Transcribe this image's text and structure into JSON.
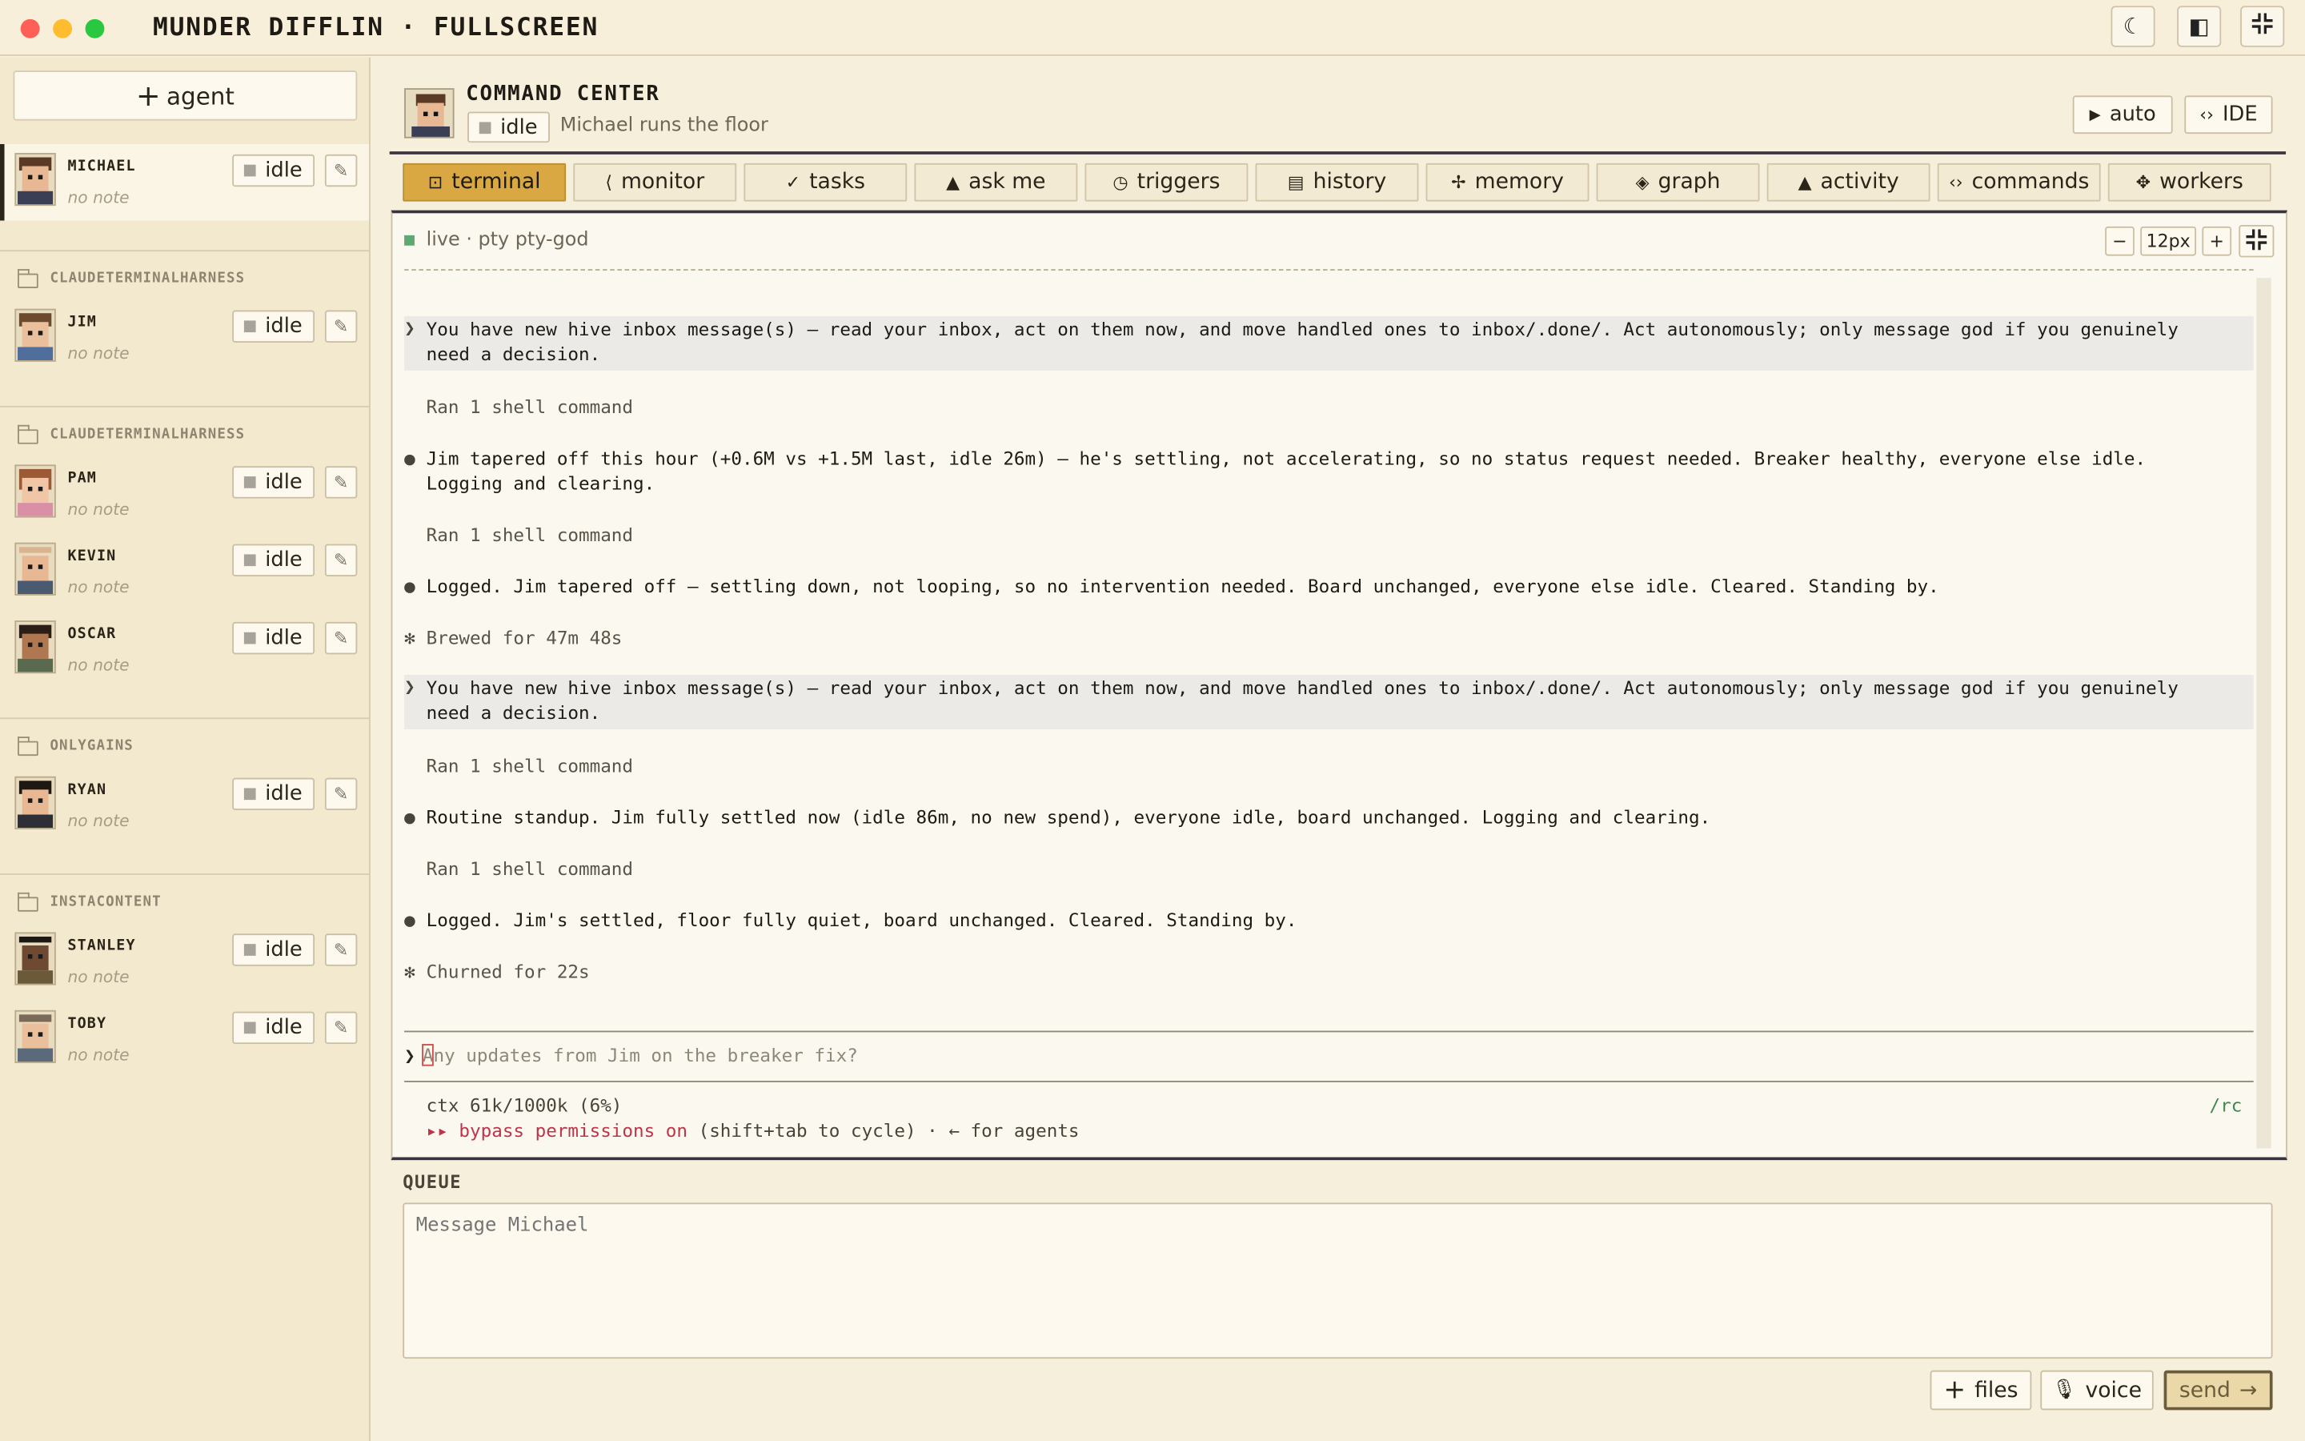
{
  "window": {
    "title": "MUNDER DIFFLIN · FULLSCREEN"
  },
  "titlebar_buttons": [
    {
      "icon": "moon-icon",
      "glyph": "☾"
    },
    {
      "icon": "sidebar-toggle-icon",
      "glyph": "◧"
    },
    {
      "icon": "fullscreen-exit-icon",
      "glyph": "⊹"
    }
  ],
  "sidebar": {
    "add_agent_label": "agent",
    "active_agent": {
      "name": "MICHAEL",
      "note": "no note",
      "status": "idle"
    },
    "groups": [
      {
        "name": "CLAUDETERMINALHARNESS",
        "agents": [
          {
            "name": "JIM",
            "note": "no note",
            "status": "idle"
          }
        ]
      },
      {
        "name": "CLAUDETERMINALHARNESS",
        "agents": [
          {
            "name": "PAM",
            "note": "no note",
            "status": "idle"
          },
          {
            "name": "KEVIN",
            "note": "no note",
            "status": "idle"
          },
          {
            "name": "OSCAR",
            "note": "no note",
            "status": "idle"
          }
        ]
      },
      {
        "name": "ONLYGAINS",
        "agents": [
          {
            "name": "RYAN",
            "note": "no note",
            "status": "idle"
          }
        ]
      },
      {
        "name": "INSTACONTENT",
        "agents": [
          {
            "name": "STANLEY",
            "note": "no note",
            "status": "idle"
          },
          {
            "name": "TOBY",
            "note": "no note",
            "status": "idle"
          }
        ]
      }
    ]
  },
  "header": {
    "title": "COMMAND CENTER",
    "status": "idle",
    "subtitle": "Michael runs the floor",
    "auto_label": "auto",
    "ide_label": "IDE"
  },
  "tabs": [
    {
      "label": "terminal",
      "icon": "terminal-icon",
      "glyph": "⊡",
      "active": true
    },
    {
      "label": "monitor",
      "icon": "monitor-icon",
      "glyph": "⟨",
      "active": false
    },
    {
      "label": "tasks",
      "icon": "check-icon",
      "glyph": "✓",
      "active": false
    },
    {
      "label": "ask me",
      "icon": "bell-icon",
      "glyph": "▲",
      "active": false
    },
    {
      "label": "triggers",
      "icon": "clock-icon",
      "glyph": "◷",
      "active": false
    },
    {
      "label": "history",
      "icon": "document-icon",
      "glyph": "▤",
      "active": false
    },
    {
      "label": "memory",
      "icon": "sparkle-icon",
      "glyph": "✢",
      "active": false
    },
    {
      "label": "graph",
      "icon": "graph-icon",
      "glyph": "◈",
      "active": false
    },
    {
      "label": "activity",
      "icon": "bell-icon",
      "glyph": "▲",
      "active": false
    },
    {
      "label": "commands",
      "icon": "code-icon",
      "glyph": "‹›",
      "active": false
    },
    {
      "label": "workers",
      "icon": "gear-icon",
      "glyph": "✥",
      "active": false
    }
  ],
  "terminal": {
    "live_label": "live · pty pty-god",
    "font_size": "12px",
    "log": [
      {
        "kind": "user",
        "gutter": "❯",
        "text": "You have new hive inbox message(s) — read your inbox, act on them now, and move handled ones to inbox/.done/. Act autonomously; only message god if you genuinely\nneed a decision."
      },
      {
        "kind": "dim",
        "gutter": "",
        "text": "Ran 1 shell command"
      },
      {
        "kind": "bullet",
        "gutter": "●",
        "text": "Jim tapered off this hour (+0.6M vs +1.5M last, idle 26m) — he's settling, not accelerating, so no status request needed. Breaker healthy, everyone else idle.\nLogging and clearing."
      },
      {
        "kind": "dim",
        "gutter": "",
        "text": "Ran 1 shell command"
      },
      {
        "kind": "bullet",
        "gutter": "●",
        "text": "Logged. Jim tapered off — settling down, not looping, so no intervention needed. Board unchanged, everyone else idle. Cleared. Standing by."
      },
      {
        "kind": "dim",
        "gutter": "✻",
        "text": "Brewed for 47m 48s"
      },
      {
        "kind": "user",
        "gutter": "❯",
        "text": "You have new hive inbox message(s) — read your inbox, act on them now, and move handled ones to inbox/.done/. Act autonomously; only message god if you genuinely\nneed a decision."
      },
      {
        "kind": "dim",
        "gutter": "",
        "text": "Ran 1 shell command"
      },
      {
        "kind": "bullet",
        "gutter": "●",
        "text": "Routine standup. Jim fully settled now (idle 86m, no new spend), everyone idle, board unchanged. Logging and clearing."
      },
      {
        "kind": "dim",
        "gutter": "",
        "text": "Ran 1 shell command"
      },
      {
        "kind": "bullet",
        "gutter": "●",
        "text": "Logged. Jim's settled, floor fully quiet, board unchanged. Cleared. Standing by."
      },
      {
        "kind": "dim",
        "gutter": "✻",
        "text": "Churned for 22s"
      }
    ],
    "prompt_placeholder": "Any updates from Jim on the breaker fix?",
    "ctx": "ctx 61k/1000k (6%)",
    "bypass_on": "▸▸ bypass permissions on",
    "bypass_rest": " (shift+tab to cycle) · ← for agents",
    "rc": "/rc"
  },
  "queue": {
    "label": "QUEUE",
    "placeholder": "Message Michael",
    "files_label": "files",
    "voice_label": "voice",
    "send_label": "send"
  },
  "colors": {
    "accent": "#d9a842",
    "background": "#f6efdc",
    "live": "#5fa872",
    "bypass": "#c0334a"
  }
}
